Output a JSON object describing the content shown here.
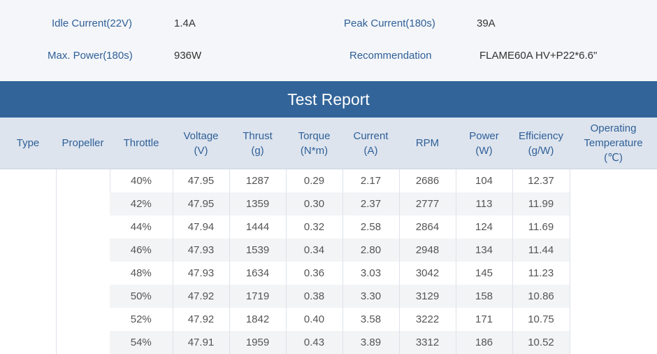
{
  "specs": {
    "idle_current_label": "Idle Current(22V)",
    "idle_current_value": "1.4A",
    "peak_current_label": "Peak Current(180s)",
    "peak_current_value": "39A",
    "max_power_label": "Max. Power(180s)",
    "max_power_value": "936W",
    "recommendation_label": "Recommendation",
    "recommendation_value": "FLAME60A HV+P22*6.6\""
  },
  "report": {
    "title": "Test Report",
    "headers": {
      "type": "Type",
      "propeller": "Propeller",
      "throttle": "Throttle",
      "voltage": "Voltage",
      "voltage_unit": "(V)",
      "thrust": "Thrust",
      "thrust_unit": "(g)",
      "torque": "Torque",
      "torque_unit": "(N*m)",
      "current": "Current",
      "current_unit": "(A)",
      "rpm": "RPM",
      "power": "Power",
      "power_unit": "(W)",
      "efficiency": "Efficiency",
      "efficiency_unit": "(g/W)",
      "temperature": "Operating",
      "temperature_line2": "Temperature",
      "temperature_unit": "(℃)"
    },
    "rows": [
      {
        "throttle": "40%",
        "voltage": "47.95",
        "thrust": "1287",
        "torque": "0.29",
        "current": "2.17",
        "rpm": "2686",
        "power": "104",
        "efficiency": "12.37"
      },
      {
        "throttle": "42%",
        "voltage": "47.95",
        "thrust": "1359",
        "torque": "0.30",
        "current": "2.37",
        "rpm": "2777",
        "power": "113",
        "efficiency": "11.99"
      },
      {
        "throttle": "44%",
        "voltage": "47.94",
        "thrust": "1444",
        "torque": "0.32",
        "current": "2.58",
        "rpm": "2864",
        "power": "124",
        "efficiency": "11.69"
      },
      {
        "throttle": "46%",
        "voltage": "47.93",
        "thrust": "1539",
        "torque": "0.34",
        "current": "2.80",
        "rpm": "2948",
        "power": "134",
        "efficiency": "11.44"
      },
      {
        "throttle": "48%",
        "voltage": "47.93",
        "thrust": "1634",
        "torque": "0.36",
        "current": "3.03",
        "rpm": "3042",
        "power": "145",
        "efficiency": "11.23"
      },
      {
        "throttle": "50%",
        "voltage": "47.92",
        "thrust": "1719",
        "torque": "0.38",
        "current": "3.30",
        "rpm": "3129",
        "power": "158",
        "efficiency": "10.86"
      },
      {
        "throttle": "52%",
        "voltage": "47.92",
        "thrust": "1842",
        "torque": "0.40",
        "current": "3.58",
        "rpm": "3222",
        "power": "171",
        "efficiency": "10.75"
      },
      {
        "throttle": "54%",
        "voltage": "47.91",
        "thrust": "1959",
        "torque": "0.43",
        "current": "3.89",
        "rpm": "3312",
        "power": "186",
        "efficiency": "10.52"
      }
    ]
  }
}
